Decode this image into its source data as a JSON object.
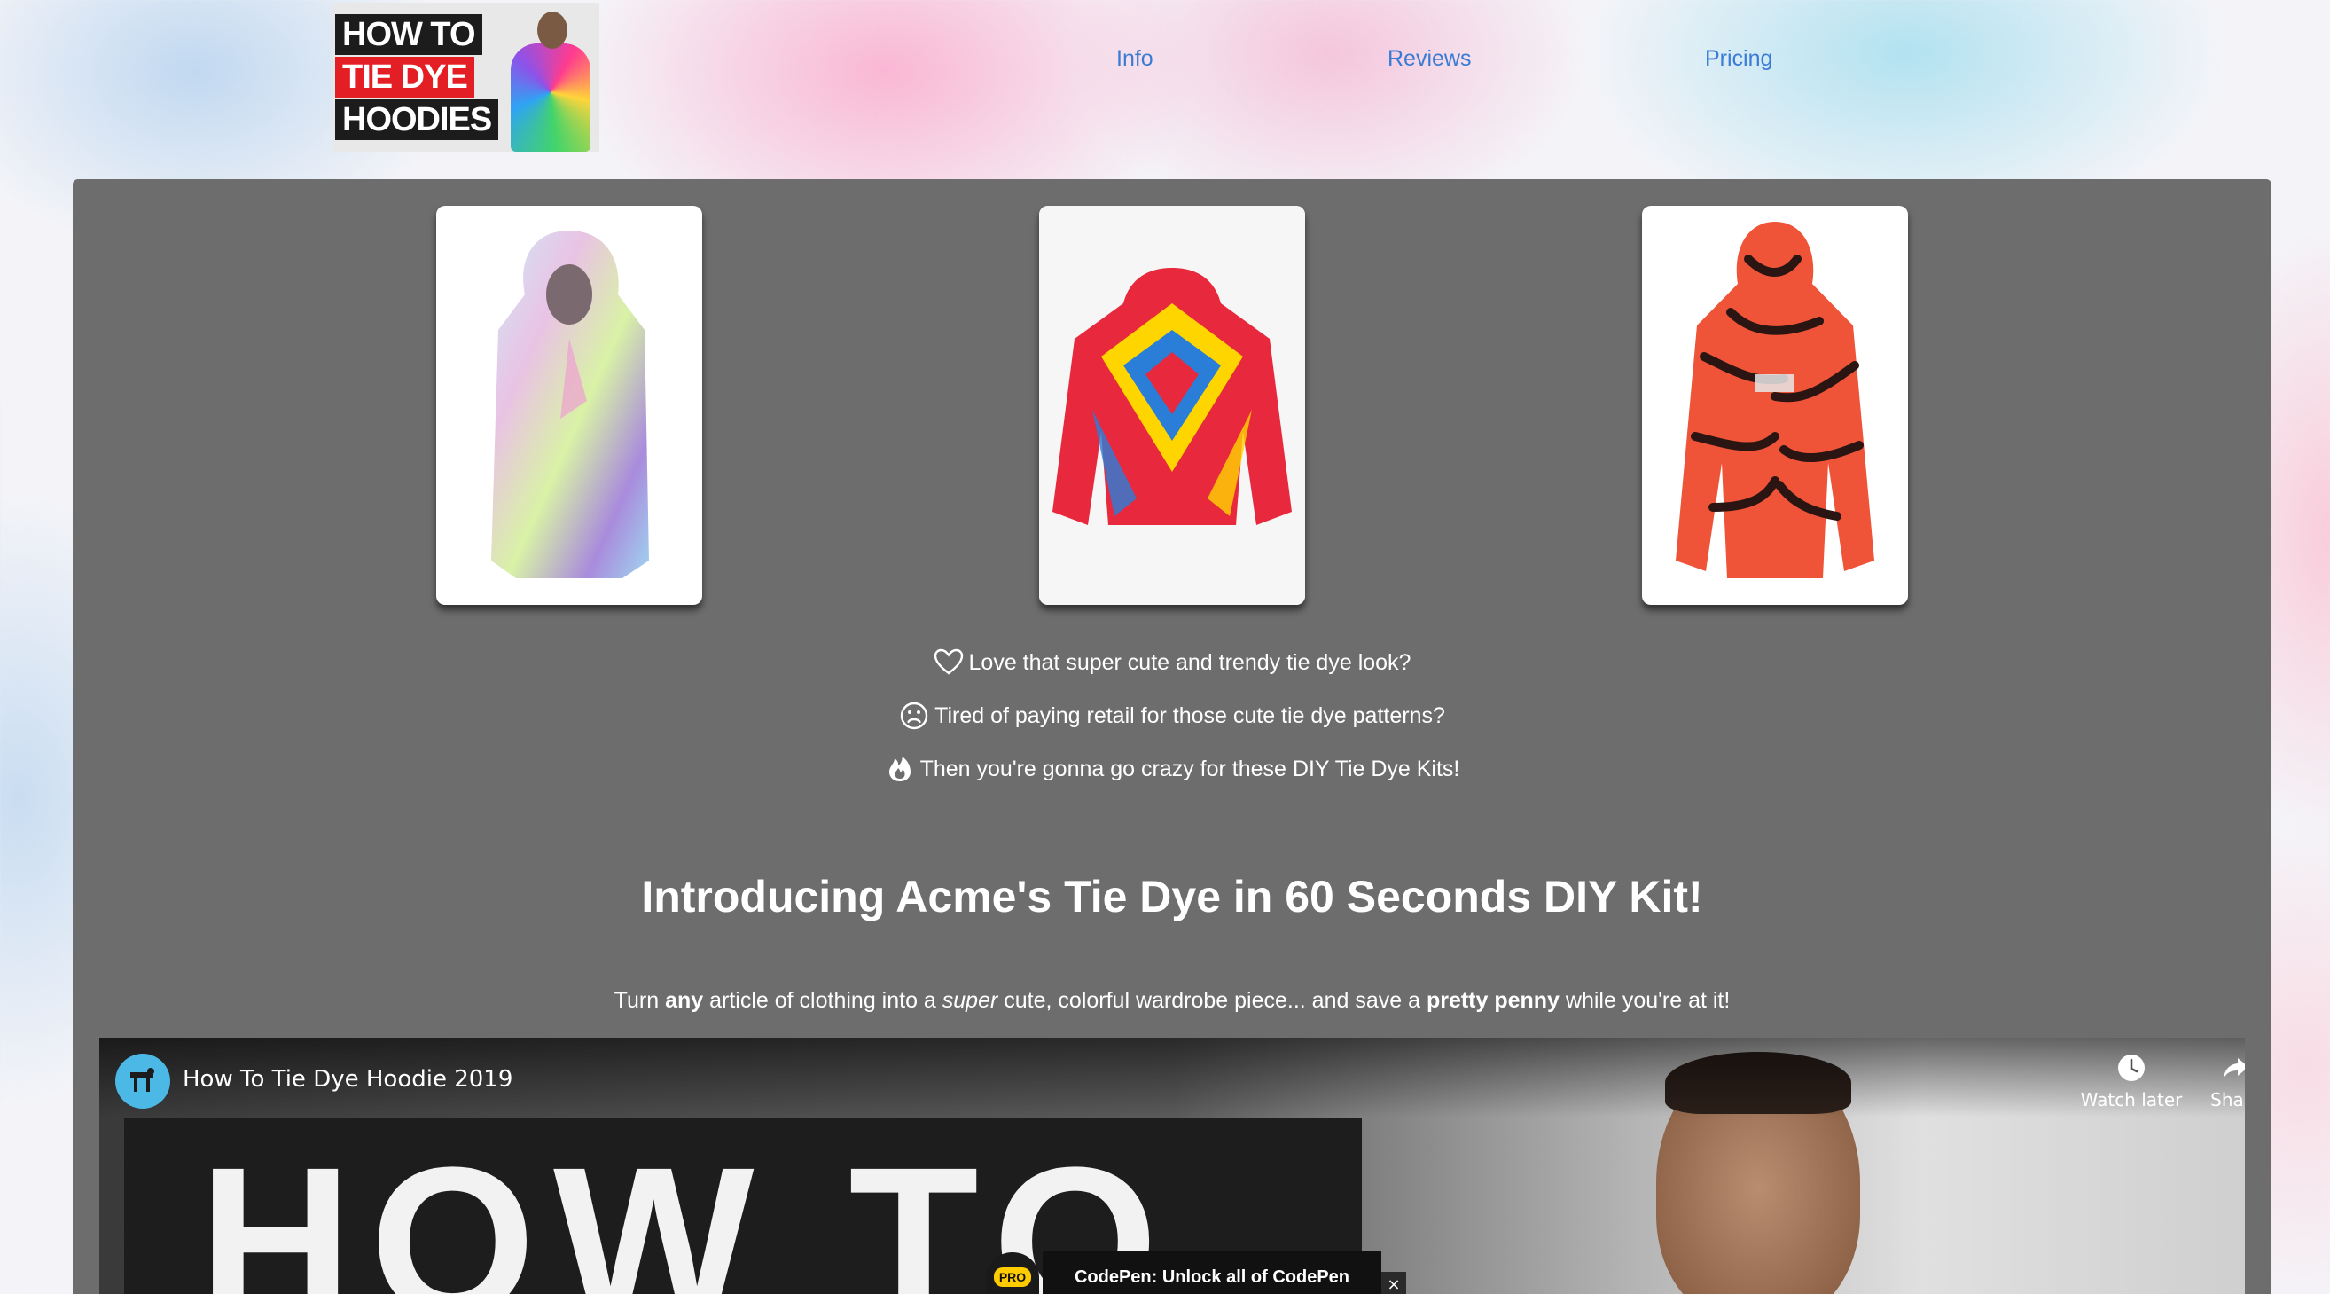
{
  "header": {
    "logo": {
      "lines": [
        "HOW TO",
        "TIE DYE",
        "HOODIES"
      ]
    },
    "nav": [
      {
        "label": "Info"
      },
      {
        "label": "Reviews"
      },
      {
        "label": "Pricing"
      }
    ]
  },
  "gallery": {
    "cards": [
      {
        "icon": "pastel-tie-dye-hoodie-image"
      },
      {
        "icon": "rainbow-tie-dye-hoodie-image"
      },
      {
        "icon": "red-black-tie-dye-hoodie-image"
      }
    ]
  },
  "features": [
    {
      "icon": "heart-icon",
      "text": "Love that super cute and trendy tie dye look?"
    },
    {
      "icon": "sad-face-icon",
      "text": "Tired of paying retail for those cute tie dye patterns?"
    },
    {
      "icon": "fire-icon",
      "text": "Then you're gonna go crazy for these DIY Tie Dye Kits!"
    }
  ],
  "headline": "Introducing Acme's Tie Dye in 60 Seconds DIY Kit!",
  "subline": {
    "p1": "Turn ",
    "b1": "any",
    "p2": " article of clothing into a ",
    "i1": "super",
    "p3": " cute, colorful wardrobe piece... and save a ",
    "b2": "pretty penny",
    "p4": " while you're at it!"
  },
  "video": {
    "title": "How To Tie Dye Hoodie 2019",
    "watch_later": "Watch later",
    "share": "Share",
    "thumbnail_text": "HOW TO"
  },
  "codepen": {
    "pro_badge": "PRO",
    "banner": "CodePen: Unlock all of CodePen",
    "close": "×"
  },
  "colors": {
    "panel": "#6d6d6d",
    "nav_link": "#3a7bd5",
    "text": "#ffffff"
  }
}
